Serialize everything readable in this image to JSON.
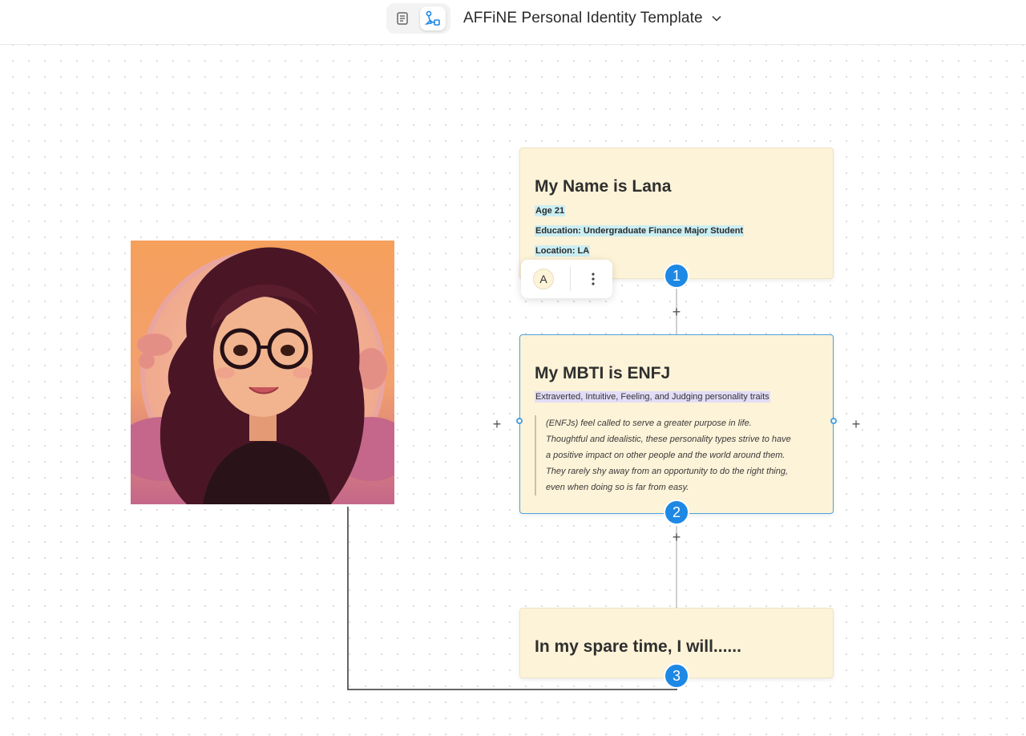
{
  "header": {
    "title": "AFFiNE Personal Identity Template",
    "mode_page_icon": "page-icon",
    "mode_edgeless_icon": "edgeless-icon"
  },
  "cards": {
    "name": {
      "heading": "My Name is Lana",
      "age": "Age 21",
      "education": "Education: Undergraduate Finance Major Student",
      "location": "Location: LA",
      "badge": "1"
    },
    "mbti": {
      "heading": "My MBTI is ENFJ",
      "traits": "Extraverted, Intuitive, Feeling, and Judging personality traits",
      "quote_lines": [
        "(ENFJs) feel called to serve a greater purpose in life.",
        "Thoughtful and idealistic, these personality types strive to have",
        "a positive impact on other people and the world around them.",
        "They rarely shy away from an opportunity to do the right thing,",
        "even when doing so is far from easy."
      ],
      "badge": "2"
    },
    "spare": {
      "heading": "In my spare time, I will......",
      "badge": "3"
    }
  },
  "toolbar": {
    "avatar_letter": "A"
  },
  "colors": {
    "card_bg": "#fdf3d8",
    "badge_blue": "#1e88e5",
    "selection_blue": "#4aa3df",
    "highlight_cyan": "#cbeef2",
    "highlight_purple": "#e2dcf7"
  }
}
